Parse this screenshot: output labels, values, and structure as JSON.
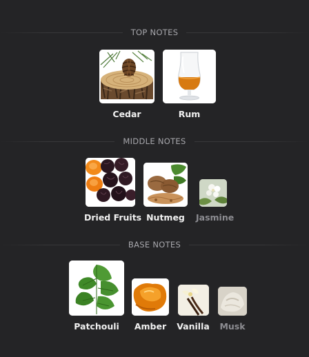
{
  "sections": [
    {
      "heading": "TOP NOTES",
      "notes": [
        {
          "label": "Cedar",
          "icon": "cedar-wood-slice-icon"
        },
        {
          "label": "Rum",
          "icon": "rum-glass-icon"
        }
      ]
    },
    {
      "heading": "MIDDLE NOTES",
      "notes": [
        {
          "label": "Dried Fruits",
          "icon": "dried-fruits-icon"
        },
        {
          "label": "Nutmeg",
          "icon": "nutmeg-icon"
        },
        {
          "label": "Jasmine",
          "icon": "jasmine-flower-icon"
        }
      ]
    },
    {
      "heading": "BASE NOTES",
      "notes": [
        {
          "label": "Patchouli",
          "icon": "patchouli-leaves-icon"
        },
        {
          "label": "Amber",
          "icon": "amber-resin-icon"
        },
        {
          "label": "Vanilla",
          "icon": "vanilla-flower-icon"
        },
        {
          "label": "Musk",
          "icon": "musk-icon"
        }
      ]
    }
  ],
  "colors": {
    "background": "#242426",
    "heading_text": "#a7a7ac",
    "label_text": "#f1f1f1",
    "label_text_dim": "#8d8d92"
  }
}
